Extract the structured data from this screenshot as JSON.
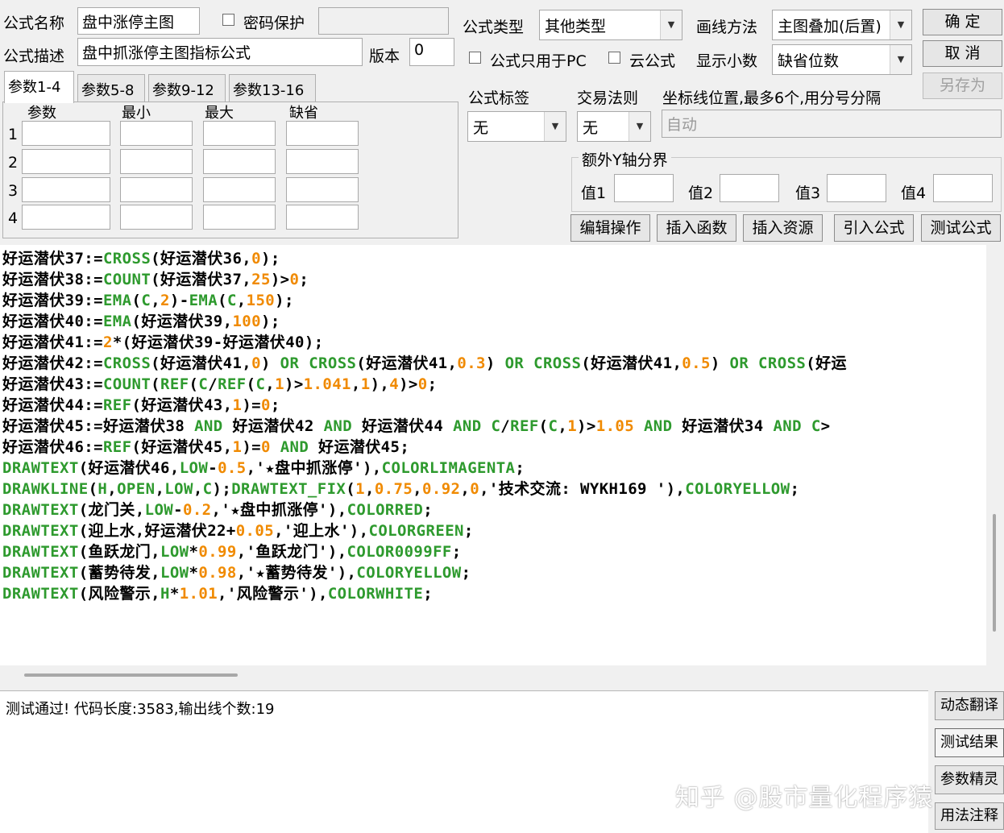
{
  "header": {
    "name_label": "公式名称",
    "name_value": "盘中涨停主图",
    "password_label": "密码保护",
    "desc_label": "公式描述",
    "desc_value": "盘中抓涨停主图指标公式",
    "version_label": "版本",
    "version_value": "0",
    "type_label": "公式类型",
    "type_value": "其他类型",
    "draw_method_label": "画线方法",
    "draw_method_value": "主图叠加(后置)",
    "pc_only_label": "公式只用于PC",
    "cloud_label": "云公式",
    "decimals_label": "显示小数",
    "decimals_value": "缺省位数",
    "tag_label": "公式标签",
    "tag_value": "无",
    "trade_rule_label": "交易法则",
    "trade_rule_value": "无",
    "axis_label": "坐标线位置,最多6个,用分号分隔",
    "axis_value": "自动",
    "extra_y_label": "额外Y轴分界",
    "val_labels": [
      "值1",
      "值2",
      "值3",
      "值4"
    ]
  },
  "buttons": {
    "ok": "确  定",
    "cancel": "取  消",
    "save_as": "另存为",
    "edit_ops": "编辑操作",
    "insert_func": "插入函数",
    "insert_res": "插入资源",
    "import_formula": "引入公式",
    "test_formula": "测试公式"
  },
  "params": {
    "tabs": [
      "参数1-4",
      "参数5-8",
      "参数9-12",
      "参数13-16"
    ],
    "columns": [
      "参数",
      "最小",
      "最大",
      "缺省"
    ],
    "rows": [
      "1",
      "2",
      "3",
      "4"
    ]
  },
  "code_lines": [
    [
      [
        "p",
        "好运潜伏37:="
      ],
      [
        "k",
        "CROSS"
      ],
      [
        "p",
        "(好运潜伏36,"
      ],
      [
        "n",
        "0"
      ],
      [
        "p",
        ");"
      ]
    ],
    [
      [
        "p",
        "好运潜伏38:="
      ],
      [
        "k",
        "COUNT"
      ],
      [
        "p",
        "(好运潜伏37,"
      ],
      [
        "n",
        "25"
      ],
      [
        "p",
        ")>"
      ],
      [
        "n",
        "0"
      ],
      [
        "p",
        ";"
      ]
    ],
    [
      [
        "p",
        "好运潜伏39:="
      ],
      [
        "k",
        "EMA"
      ],
      [
        "p",
        "("
      ],
      [
        "k",
        "C"
      ],
      [
        "p",
        ","
      ],
      [
        "n",
        "2"
      ],
      [
        "p",
        ")-"
      ],
      [
        "k",
        "EMA"
      ],
      [
        "p",
        "("
      ],
      [
        "k",
        "C"
      ],
      [
        "p",
        ","
      ],
      [
        "n",
        "150"
      ],
      [
        "p",
        ");"
      ]
    ],
    [
      [
        "p",
        "好运潜伏40:="
      ],
      [
        "k",
        "EMA"
      ],
      [
        "p",
        "(好运潜伏39,"
      ],
      [
        "n",
        "100"
      ],
      [
        "p",
        ");"
      ]
    ],
    [
      [
        "p",
        "好运潜伏41:="
      ],
      [
        "n",
        "2"
      ],
      [
        "p",
        "*(好运潜伏39-好运潜伏40);"
      ]
    ],
    [
      [
        "p",
        "好运潜伏42:="
      ],
      [
        "k",
        "CROSS"
      ],
      [
        "p",
        "(好运潜伏41,"
      ],
      [
        "n",
        "0"
      ],
      [
        "p",
        ") "
      ],
      [
        "k",
        "OR"
      ],
      [
        "p",
        " "
      ],
      [
        "k",
        "CROSS"
      ],
      [
        "p",
        "(好运潜伏41,"
      ],
      [
        "n",
        "0.3"
      ],
      [
        "p",
        ") "
      ],
      [
        "k",
        "OR"
      ],
      [
        "p",
        " "
      ],
      [
        "k",
        "CROSS"
      ],
      [
        "p",
        "(好运潜伏41,"
      ],
      [
        "n",
        "0.5"
      ],
      [
        "p",
        ") "
      ],
      [
        "k",
        "OR"
      ],
      [
        "p",
        " "
      ],
      [
        "k",
        "CROSS"
      ],
      [
        "p",
        "(好运"
      ]
    ],
    [
      [
        "p",
        "好运潜伏43:="
      ],
      [
        "k",
        "COUNT"
      ],
      [
        "p",
        "("
      ],
      [
        "k",
        "REF"
      ],
      [
        "p",
        "("
      ],
      [
        "k",
        "C"
      ],
      [
        "p",
        "/"
      ],
      [
        "k",
        "REF"
      ],
      [
        "p",
        "("
      ],
      [
        "k",
        "C"
      ],
      [
        "p",
        ","
      ],
      [
        "n",
        "1"
      ],
      [
        "p",
        ")>"
      ],
      [
        "n",
        "1.041"
      ],
      [
        "p",
        ","
      ],
      [
        "n",
        "1"
      ],
      [
        "p",
        "),"
      ],
      [
        "n",
        "4"
      ],
      [
        "p",
        ")>"
      ],
      [
        "n",
        "0"
      ],
      [
        "p",
        ";"
      ]
    ],
    [
      [
        "p",
        "好运潜伏44:="
      ],
      [
        "k",
        "REF"
      ],
      [
        "p",
        "(好运潜伏43,"
      ],
      [
        "n",
        "1"
      ],
      [
        "p",
        ")="
      ],
      [
        "n",
        "0"
      ],
      [
        "p",
        ";"
      ]
    ],
    [
      [
        "p",
        "好运潜伏45:=好运潜伏38 "
      ],
      [
        "k",
        "AND"
      ],
      [
        "p",
        " 好运潜伏42 "
      ],
      [
        "k",
        "AND"
      ],
      [
        "p",
        " 好运潜伏44 "
      ],
      [
        "k",
        "AND"
      ],
      [
        "p",
        " "
      ],
      [
        "k",
        "C"
      ],
      [
        "p",
        "/"
      ],
      [
        "k",
        "REF"
      ],
      [
        "p",
        "("
      ],
      [
        "k",
        "C"
      ],
      [
        "p",
        ","
      ],
      [
        "n",
        "1"
      ],
      [
        "p",
        ")>"
      ],
      [
        "n",
        "1.05"
      ],
      [
        "p",
        " "
      ],
      [
        "k",
        "AND"
      ],
      [
        "p",
        " 好运潜伏34 "
      ],
      [
        "k",
        "AND"
      ],
      [
        "p",
        " "
      ],
      [
        "k",
        "C"
      ],
      [
        "p",
        ">"
      ]
    ],
    [
      [
        "p",
        "好运潜伏46:="
      ],
      [
        "k",
        "REF"
      ],
      [
        "p",
        "(好运潜伏45,"
      ],
      [
        "n",
        "1"
      ],
      [
        "p",
        ")="
      ],
      [
        "n",
        "0"
      ],
      [
        "p",
        " "
      ],
      [
        "k",
        "AND"
      ],
      [
        "p",
        " 好运潜伏45;"
      ]
    ],
    [
      [
        "k",
        "DRAWTEXT"
      ],
      [
        "p",
        "(好运潜伏46,"
      ],
      [
        "k",
        "LOW"
      ],
      [
        "p",
        "-"
      ],
      [
        "n",
        "0.5"
      ],
      [
        "p",
        ",'★盘中抓涨停'),"
      ],
      [
        "k",
        "COLORLIMAGENTA"
      ],
      [
        "p",
        ";"
      ]
    ],
    [
      [
        "k",
        "DRAWKLINE"
      ],
      [
        "p",
        "("
      ],
      [
        "k",
        "H"
      ],
      [
        "p",
        ","
      ],
      [
        "k",
        "OPEN"
      ],
      [
        "p",
        ","
      ],
      [
        "k",
        "LOW"
      ],
      [
        "p",
        ","
      ],
      [
        "k",
        "C"
      ],
      [
        "p",
        ");"
      ],
      [
        "k",
        "DRAWTEXT_FIX"
      ],
      [
        "p",
        "("
      ],
      [
        "n",
        "1"
      ],
      [
        "p",
        ","
      ],
      [
        "n",
        "0.75"
      ],
      [
        "p",
        ","
      ],
      [
        "n",
        "0.92"
      ],
      [
        "p",
        ","
      ],
      [
        "n",
        "0"
      ],
      [
        "p",
        ",'技术交流: WYKH169 '),"
      ],
      [
        "k",
        "COLORYELLOW"
      ],
      [
        "p",
        ";"
      ]
    ],
    [
      [
        "k",
        "DRAWTEXT"
      ],
      [
        "p",
        "(龙门关,"
      ],
      [
        "k",
        "LOW"
      ],
      [
        "p",
        "-"
      ],
      [
        "n",
        "0.2"
      ],
      [
        "p",
        ",'★盘中抓涨停'),"
      ],
      [
        "k",
        "COLORRED"
      ],
      [
        "p",
        ";"
      ]
    ],
    [
      [
        "k",
        "DRAWTEXT"
      ],
      [
        "p",
        "(迎上水,好运潜伏22+"
      ],
      [
        "n",
        "0.05"
      ],
      [
        "p",
        ",'迎上水'),"
      ],
      [
        "k",
        "COLORGREEN"
      ],
      [
        "p",
        ";"
      ]
    ],
    [
      [
        "k",
        "DRAWTEXT"
      ],
      [
        "p",
        "(鱼跃龙门,"
      ],
      [
        "k",
        "LOW"
      ],
      [
        "p",
        "*"
      ],
      [
        "n",
        "0.99"
      ],
      [
        "p",
        ",'鱼跃龙门'),"
      ],
      [
        "k",
        "COLOR0099FF"
      ],
      [
        "p",
        ";"
      ]
    ],
    [
      [
        "k",
        "DRAWTEXT"
      ],
      [
        "p",
        "(蓄势待发,"
      ],
      [
        "k",
        "LOW"
      ],
      [
        "p",
        "*"
      ],
      [
        "n",
        "0.98"
      ],
      [
        "p",
        ",'★蓄势待发'),"
      ],
      [
        "k",
        "COLORYELLOW"
      ],
      [
        "p",
        ";"
      ]
    ],
    [
      [
        "k",
        "DRAWTEXT"
      ],
      [
        "p",
        "(风险警示,"
      ],
      [
        "k",
        "H"
      ],
      [
        "p",
        "*"
      ],
      [
        "n",
        "1.01"
      ],
      [
        "p",
        ",'风险警示'),"
      ],
      [
        "k",
        "COLORWHITE"
      ],
      [
        "p",
        ";"
      ]
    ]
  ],
  "result": {
    "text": "测试通过! 代码长度:3583,输出线个数:19"
  },
  "side_buttons": [
    "动态翻译",
    "测试结果",
    "参数精灵",
    "用法注释"
  ],
  "watermark": "知乎 @股市量化程序猿",
  "colors": {
    "keyword": "#2e9a2e",
    "number": "#f08a00",
    "plain": "#000000"
  }
}
